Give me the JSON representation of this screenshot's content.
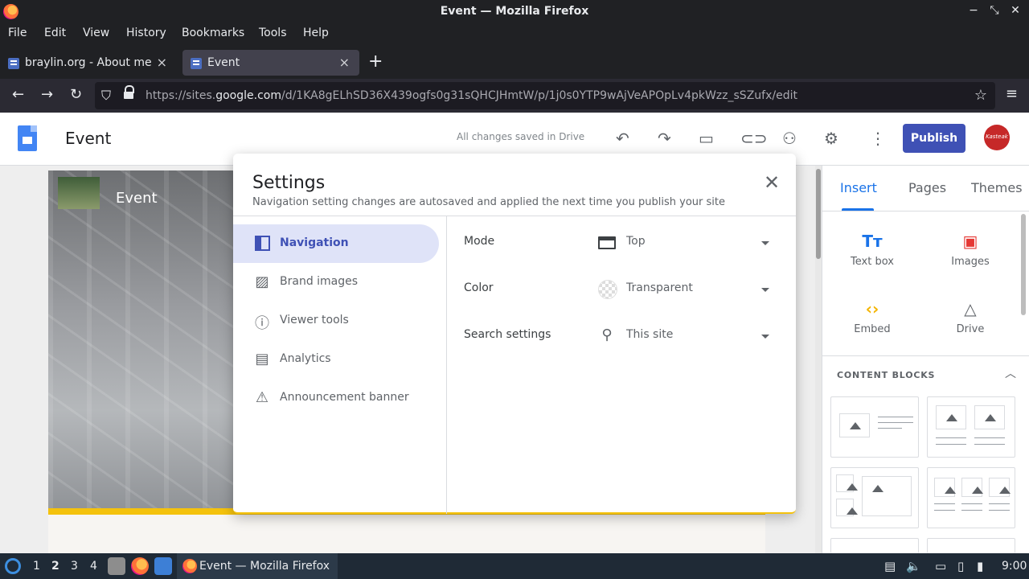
{
  "window": {
    "title": "Event — Mozilla Firefox",
    "controls": [
      "−",
      "⤡",
      "✕"
    ]
  },
  "menu": [
    "File",
    "Edit",
    "View",
    "History",
    "Bookmarks",
    "Tools",
    "Help"
  ],
  "tabs": [
    {
      "label": "braylin.org - About me",
      "active": false
    },
    {
      "label": "Event",
      "active": true
    }
  ],
  "address": {
    "prefix": "https://sites.",
    "domain": "google.com",
    "path": "/d/1KA8gELhSD36X439ogfs0g31sQHCJHmtW/p/1j0s0YTP9wAjVeAPOpLv4pkWzz_sSZufx/edit"
  },
  "sites": {
    "doc_title": "Event",
    "save_status": "All changes saved in Drive",
    "publish_label": "Publish",
    "avatar_text": "Kasteak",
    "icons": [
      "undo-icon",
      "redo-icon",
      "preview-icon",
      "link-icon",
      "share-icon",
      "settings-icon",
      "more-icon"
    ]
  },
  "hero": {
    "title": "Event",
    "accent_color": "#f4c20d"
  },
  "right_panel": {
    "tabs": [
      "Insert",
      "Pages",
      "Themes"
    ],
    "tools": [
      {
        "label": "Text box",
        "icon": "text-box-icon"
      },
      {
        "label": "Images",
        "icon": "image-icon"
      },
      {
        "label": "Embed",
        "icon": "embed-icon"
      },
      {
        "label": "Drive",
        "icon": "drive-icon"
      }
    ],
    "content_blocks_title": "CONTENT BLOCKS"
  },
  "settings": {
    "title": "Settings",
    "subtitle": "Navigation setting changes are autosaved and applied the next time you publish your site",
    "nav": [
      {
        "label": "Navigation",
        "icon": "navigation-icon",
        "active": true
      },
      {
        "label": "Brand images",
        "icon": "brand-images-icon"
      },
      {
        "label": "Viewer tools",
        "icon": "info-icon"
      },
      {
        "label": "Analytics",
        "icon": "analytics-icon"
      },
      {
        "label": "Announcement banner",
        "icon": "announcement-icon"
      }
    ],
    "rows": [
      {
        "label": "Mode",
        "value": "Top",
        "icon": "mode-top-icon"
      },
      {
        "label": "Color",
        "value": "Transparent",
        "icon": "transparent-color-icon"
      },
      {
        "label": "Search settings",
        "value": "This site",
        "icon": "search-icon"
      }
    ]
  },
  "taskbar": {
    "workspaces": [
      "1",
      "2",
      "3",
      "4"
    ],
    "current_workspace": "2",
    "task_label": "Event — Mozilla Firefox",
    "clock": "9:00"
  },
  "colors": {
    "publish": "#3f51b5",
    "active_tab_blue": "#1a73e8",
    "nav_active_bg": "#dfe3f8"
  }
}
